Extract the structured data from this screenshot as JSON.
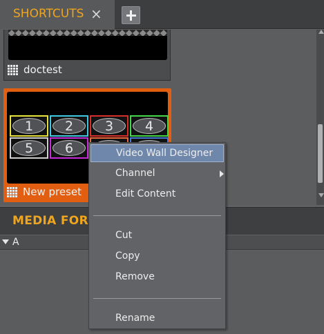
{
  "tabs": {
    "active_label": "SHORTCUTS",
    "close_glyph": "×",
    "add_icon": "plus-icon"
  },
  "shortcuts": {
    "cards": [
      {
        "label": "doctest",
        "icon": "grid-icon"
      },
      {
        "label": "New preset",
        "icon": "grid-icon",
        "selected": true
      }
    ],
    "preset_cells": [
      {
        "num": "1",
        "color": "#e8e23a"
      },
      {
        "num": "2",
        "color": "#3ec9e0"
      },
      {
        "num": "3",
        "color": "#d62d2d"
      },
      {
        "num": "4",
        "color": "#46d64b"
      },
      {
        "num": "5",
        "color": "#cfcfcf"
      },
      {
        "num": "6",
        "color": "#c62bd8"
      },
      {
        "num": "",
        "color": "#e86a3c"
      },
      {
        "num": "",
        "color": "#4a78d8"
      }
    ]
  },
  "media": {
    "title": "MEDIA FOR",
    "column_label": "A"
  },
  "context_menu": {
    "items": [
      {
        "label": "Video Wall Designer",
        "highlighted": true
      },
      {
        "label": "Channel",
        "submenu": true
      },
      {
        "label": "Edit Content"
      },
      {
        "label": "Cut"
      },
      {
        "label": "Copy"
      },
      {
        "label": "Remove"
      },
      {
        "label": "Rename"
      }
    ]
  },
  "colors": {
    "accent": "#f0a51e",
    "selection": "#e25f12",
    "menu_highlight": "#6f87ab"
  }
}
